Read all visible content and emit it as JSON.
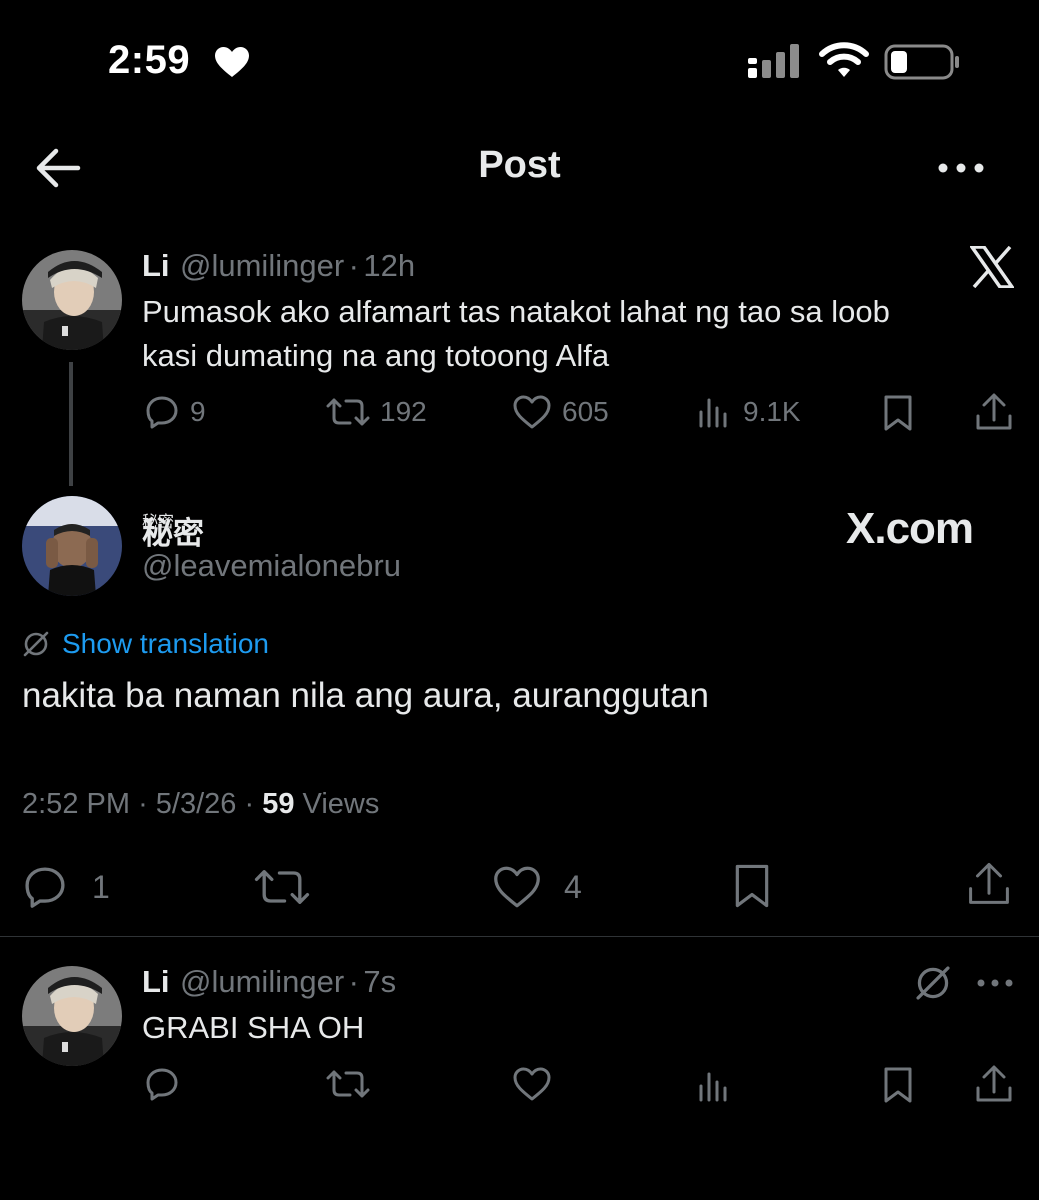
{
  "status_bar": {
    "time": "2:59"
  },
  "header": {
    "title": "Post"
  },
  "parent_post": {
    "display_name": "Li",
    "handle": "@lumilinger",
    "separator": "·",
    "time_ago": "12h",
    "text_line1": "Pumasok ako alfamart tas natakot lahat ng tao sa loob",
    "text_line2": "kasi dumating na ang totoong Alfa",
    "replies": "9",
    "reposts": "192",
    "likes": "605",
    "views": "9.1K"
  },
  "main_post": {
    "display_name": "秘密",
    "handle": "@leavemialonebru",
    "watermark": "X.com",
    "show_translation": "Show translation",
    "text": "nakita ba naman nila ang aura, auranggutan",
    "time": "2:52 PM",
    "date": "5/3/26",
    "views_count": "59",
    "views_label": "Views",
    "replies": "1",
    "likes": "4"
  },
  "reply_post": {
    "display_name": "Li",
    "handle": "@lumilinger",
    "separator": "·",
    "time_ago": "7s",
    "text": "GRABI SHA OH"
  },
  "colors": {
    "background": "#000000",
    "text": "#e7e9ea",
    "muted": "#71767b",
    "link": "#1d9bf0"
  },
  "icons": [
    "heart-icon",
    "signal-icon",
    "wifi-icon",
    "battery-icon",
    "back-arrow-icon",
    "more-icon",
    "x-logo-icon",
    "reply-icon",
    "repost-icon",
    "like-icon",
    "views-icon",
    "bookmark-icon",
    "share-icon",
    "translate-icon"
  ]
}
